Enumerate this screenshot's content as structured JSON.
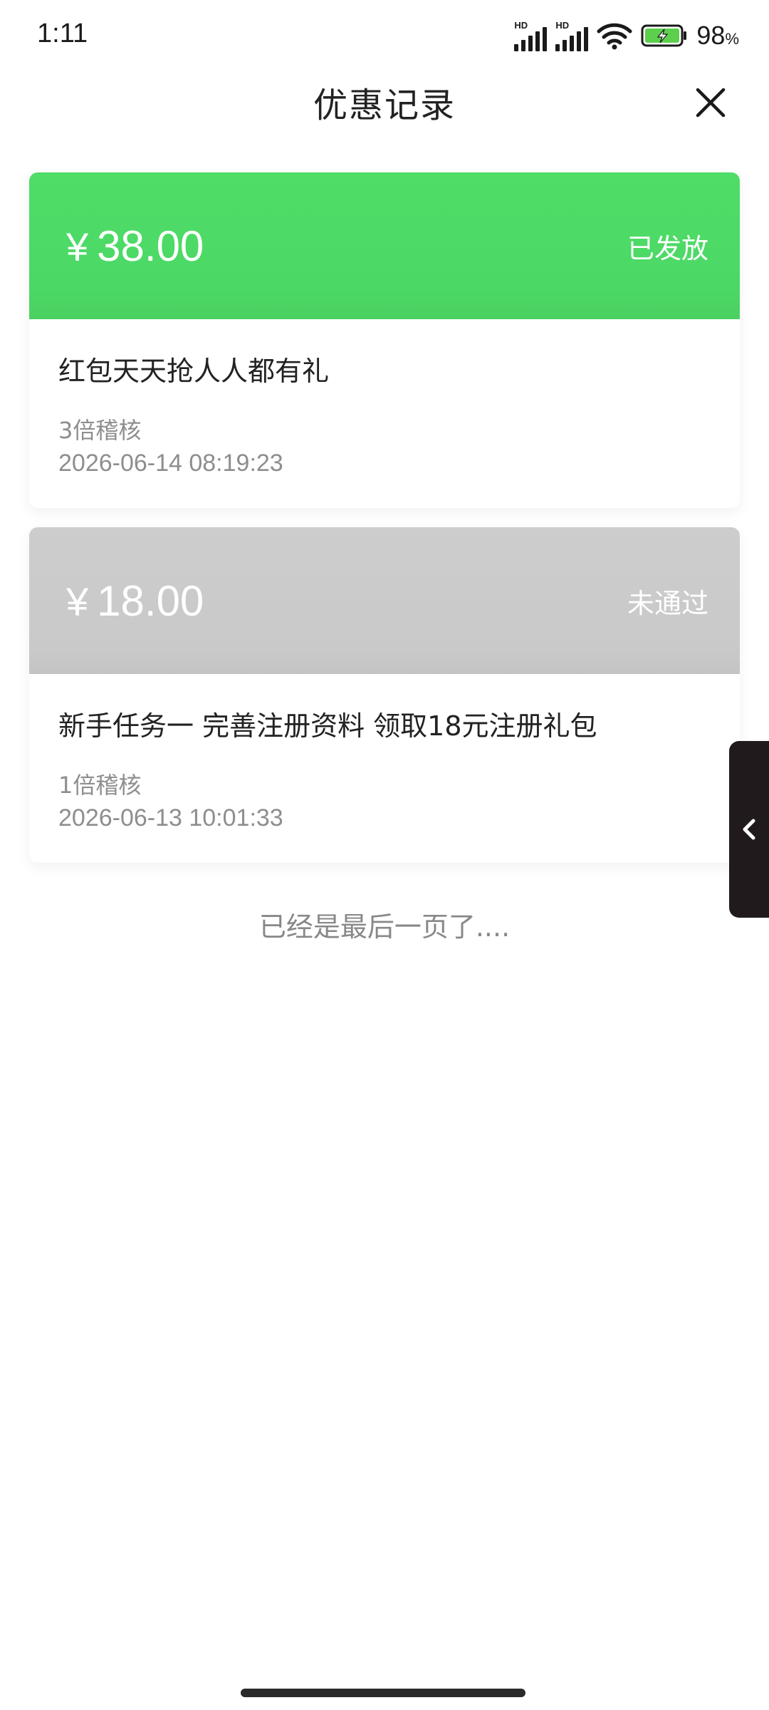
{
  "status_bar": {
    "time": "1:11",
    "signal1_label": "HD",
    "signal2_label": "HD",
    "battery": "98",
    "battery_unit": "%",
    "wifi_icon": "wifi-icon",
    "battery_icon": "battery-charging-icon"
  },
  "header": {
    "title": "优惠记录",
    "close_icon": "close-icon"
  },
  "records": [
    {
      "currency": "¥",
      "amount": "38.00",
      "status": "已发放",
      "status_color": "#4cd865",
      "title": "红包天天抢人人都有礼",
      "multiplier": "3倍稽核",
      "datetime": "2026-06-14 08:19:23"
    },
    {
      "currency": "¥",
      "amount": "18.00",
      "status": "未通过",
      "status_color": "#c9c9c9",
      "title": "新手任务一 完善注册资料 领取18元注册礼包",
      "multiplier": "1倍稽核",
      "datetime": "2026-06-13 10:01:33"
    }
  ],
  "footer": {
    "end_text": "已经是最后一页了...."
  },
  "side_tab": {
    "icon": "chevron-left-icon"
  }
}
